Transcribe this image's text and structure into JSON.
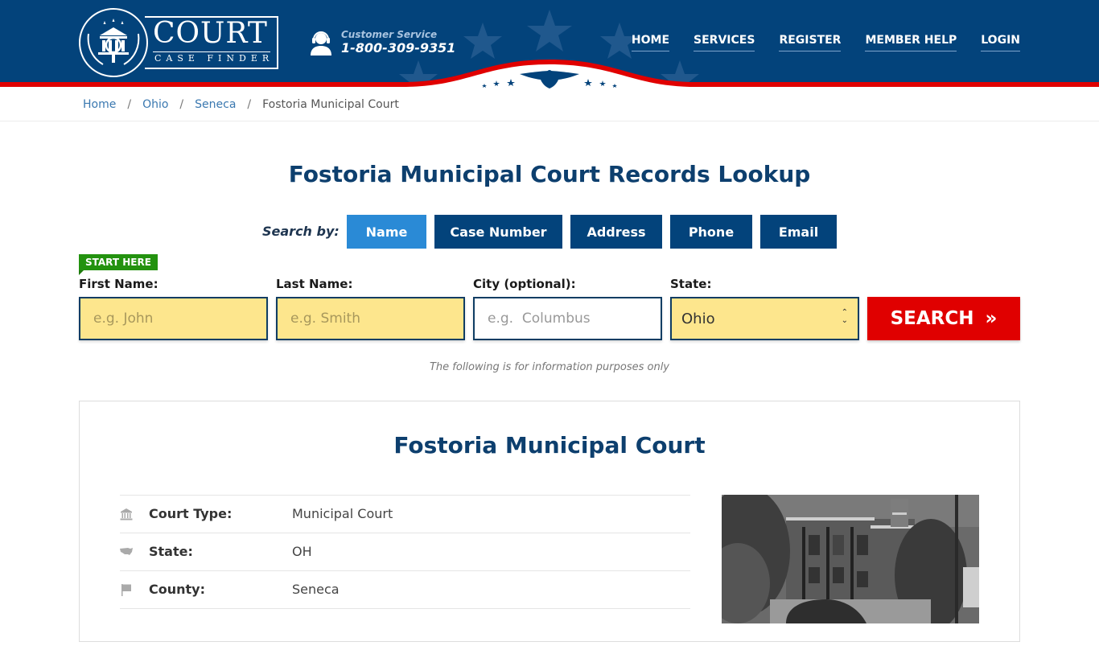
{
  "header": {
    "logo": {
      "title": "COURT",
      "subtitle": "CASE FINDER"
    },
    "customer_service": {
      "label": "Customer Service",
      "phone": "1-800-309-9351"
    },
    "nav": [
      {
        "label": "HOME"
      },
      {
        "label": "SERVICES"
      },
      {
        "label": "REGISTER"
      },
      {
        "label": "MEMBER HELP"
      },
      {
        "label": "LOGIN"
      }
    ]
  },
  "breadcrumb": [
    {
      "label": "Home"
    },
    {
      "label": "Ohio"
    },
    {
      "label": "Seneca"
    },
    {
      "label": "Fostoria Municipal Court"
    }
  ],
  "main": {
    "title": "Fostoria Municipal Court Records Lookup",
    "search_by_label": "Search by:",
    "tabs": [
      {
        "label": "Name",
        "active": true
      },
      {
        "label": "Case Number",
        "active": false
      },
      {
        "label": "Address",
        "active": false
      },
      {
        "label": "Phone",
        "active": false
      },
      {
        "label": "Email",
        "active": false
      }
    ],
    "start_here": "START HERE",
    "form": {
      "first_name": {
        "label": "First Name:",
        "placeholder": "e.g. John",
        "value": ""
      },
      "last_name": {
        "label": "Last Name:",
        "placeholder": "e.g. Smith",
        "value": ""
      },
      "city": {
        "label": "City (optional):",
        "placeholder": "e.g.  Columbus",
        "value": ""
      },
      "state": {
        "label": "State:",
        "value": "Ohio"
      },
      "search_button": "SEARCH",
      "search_icon": "double-chevron-right"
    },
    "info_note": "The following is for information purposes only"
  },
  "court": {
    "name": "Fostoria Municipal Court",
    "details": [
      {
        "icon": "courthouse-icon",
        "key": "Court Type:",
        "value": "Municipal Court"
      },
      {
        "icon": "usa-map-icon",
        "key": "State:",
        "value": "OH"
      },
      {
        "icon": "flag-icon",
        "key": "County:",
        "value": "Seneca"
      }
    ],
    "photo_alt": "Fostoria Municipal Court building"
  },
  "colors": {
    "brand_navy": "#03437b",
    "active_tab": "#2a8ad6",
    "search_red": "#e00000",
    "start_green": "#23920f",
    "input_yellow": "#fde68d"
  }
}
